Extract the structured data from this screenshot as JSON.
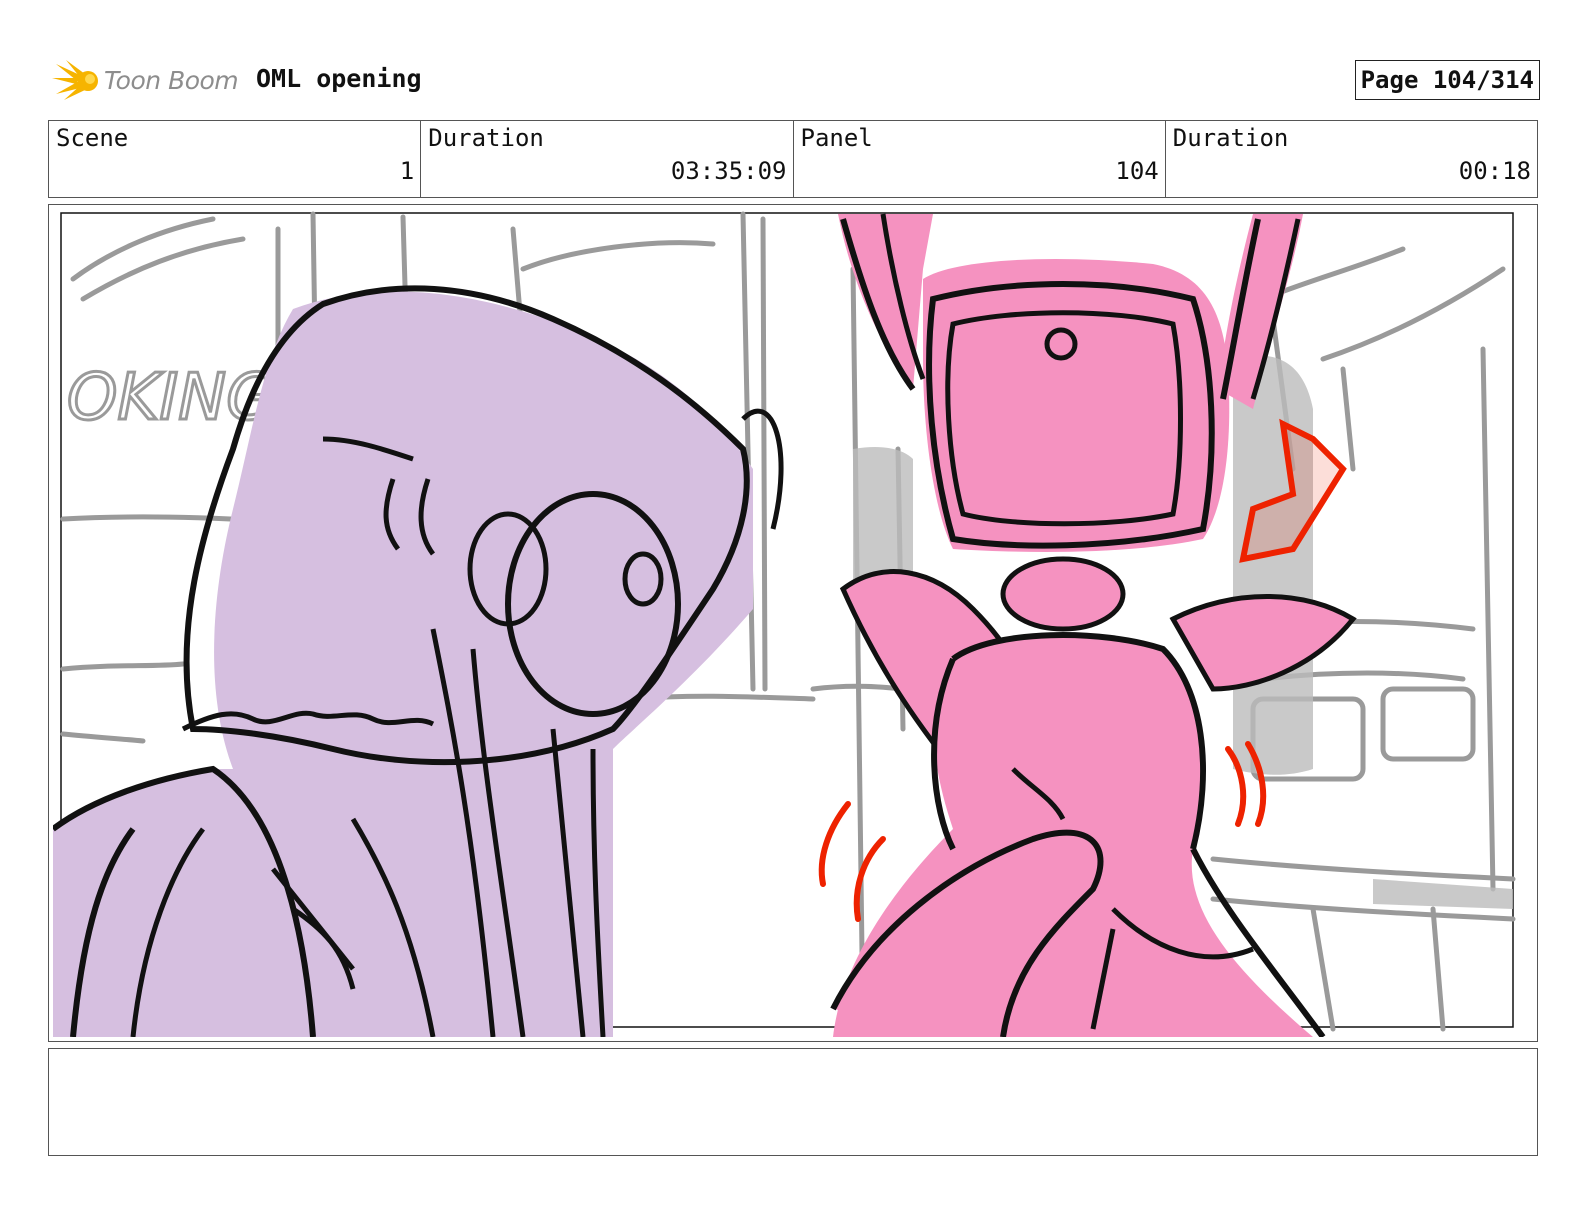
{
  "header": {
    "logo_text": "Toon Boom",
    "project_title": "OML opening",
    "page_label": "Page 104/314"
  },
  "info": {
    "scene_label": "Scene",
    "scene_value": "1",
    "scene_duration_label": "Duration",
    "scene_duration_value": "03:35:09",
    "panel_label": "Panel",
    "panel_value": "104",
    "panel_duration_label": "Duration",
    "panel_duration_value": "00:18"
  },
  "panel": {
    "sketch_text": "OKING",
    "colors": {
      "robot_fill": "#d6bfe0",
      "bunny_fill": "#f592c0",
      "accent_red": "#ee2200",
      "background_lines": "#9a9a9a",
      "ink": "#111111"
    }
  },
  "notes": {
    "text": ""
  }
}
